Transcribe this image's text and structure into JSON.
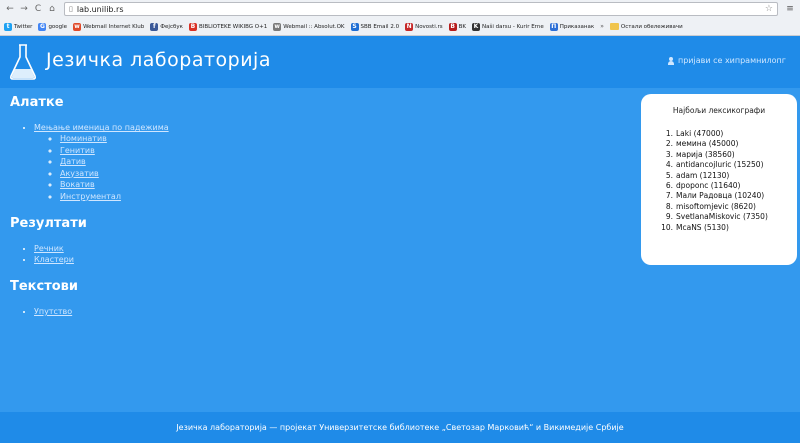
{
  "browser": {
    "url": "lab.unilib.rs",
    "nav": {
      "back": "←",
      "forward": "→",
      "reload": "C",
      "home": "⌂"
    },
    "star": "☆",
    "menu": "≡",
    "bookmarks": [
      {
        "label": "Twitter",
        "color": "#1da1f2",
        "glyph": "t"
      },
      {
        "label": "google",
        "color": "#4285f4",
        "glyph": "G"
      },
      {
        "label": "Webmail Internet Klub",
        "color": "#e04a2a",
        "glyph": "w"
      },
      {
        "label": "Фејсбук",
        "color": "#3b5998",
        "glyph": "f"
      },
      {
        "label": "BIBLIOTEKE WIKIBG O+1",
        "color": "#d93025",
        "glyph": "B"
      },
      {
        "label": "Webmail :: Absolut.OK",
        "color": "#7a7a7a",
        "glyph": "w"
      },
      {
        "label": "SBB Email 2.0",
        "color": "#1f6ed4",
        "glyph": "S"
      },
      {
        "label": "Novosti.rs",
        "color": "#c62828",
        "glyph": "N"
      },
      {
        "label": "BK",
        "color": "#b71c1c",
        "glyph": "B"
      },
      {
        "label": "Naši darsu - Kurir Erne",
        "color": "#333333",
        "glyph": "K"
      },
      {
        "label": "Приказанак",
        "color": "#2d6fd6",
        "glyph": "П"
      }
    ],
    "more": "»",
    "other_bookmarks": "Остали обележивачи"
  },
  "header": {
    "title": "Језичка лабораторија",
    "login": "пријави се хипрамнилопг"
  },
  "sections": [
    {
      "title": "Алатке",
      "items": [
        {
          "label": "Мењање именица по падежима",
          "children": [
            "Номинатив",
            "Генитив",
            "Датив",
            "Акузатив",
            "Вокатив",
            "Инструментал"
          ]
        }
      ]
    },
    {
      "title": "Резултати",
      "items": [
        {
          "label": "Речник",
          "children": []
        },
        {
          "label": "Кластери",
          "children": []
        }
      ]
    },
    {
      "title": "Текстови",
      "items": [
        {
          "label": "Упутство",
          "children": []
        }
      ]
    }
  ],
  "lexicographers": {
    "title": "Најбољи лексикографи",
    "entries": [
      {
        "rank": "1.",
        "text": "Laki (47000)"
      },
      {
        "rank": "2.",
        "text": "мемина (45000)"
      },
      {
        "rank": "3.",
        "text": "марија (38560)"
      },
      {
        "rank": "4.",
        "text": "antidancojluric (15250)"
      },
      {
        "rank": "5.",
        "text": "adam (12130)"
      },
      {
        "rank": "6.",
        "text": "dpoponc (11640)"
      },
      {
        "rank": "7.",
        "text": "Мали Радовца (10240)"
      },
      {
        "rank": "8.",
        "text": "misoftomjevic (8620)"
      },
      {
        "rank": "9.",
        "text": "SvetlanaMiskovic (7350)"
      },
      {
        "rank": "10.",
        "text": "McaNS (5130)"
      }
    ]
  },
  "footer": {
    "text": "Језичка лабораторија — пројекат Универзитетске библиотеке „Светозар Марковић“ и Викимедије Србије"
  }
}
